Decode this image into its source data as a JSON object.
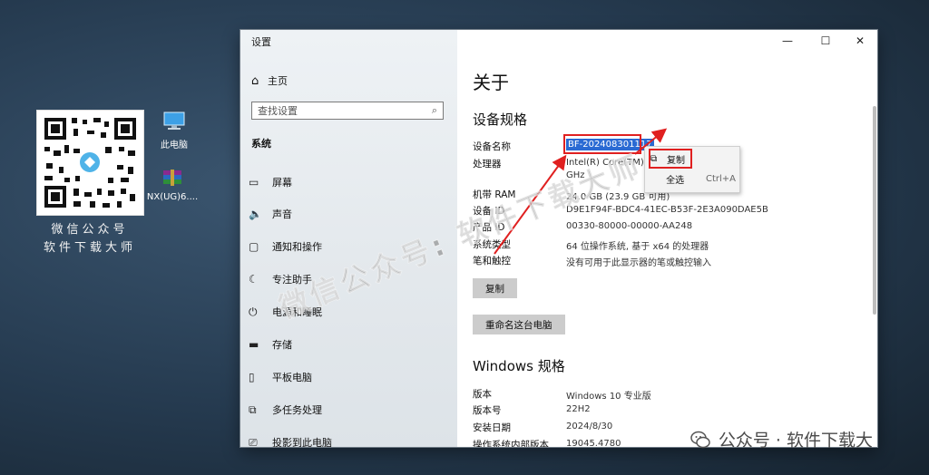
{
  "desktop": {
    "qr_caption_line1": "微信公众号",
    "qr_caption_line2": "软件下载大师",
    "icons": [
      {
        "label": "此电脑"
      },
      {
        "label": "NX(UG)6...."
      }
    ]
  },
  "window": {
    "title": "设置",
    "controls": {
      "minimize": "—",
      "maximize": "☐",
      "close": "✕"
    },
    "sidebar": {
      "home": "主页",
      "search_placeholder": "查找设置",
      "section": "系统",
      "items": [
        {
          "label": "屏幕",
          "icon": "monitor-icon"
        },
        {
          "label": "声音",
          "icon": "speaker-icon"
        },
        {
          "label": "通知和操作",
          "icon": "notification-icon"
        },
        {
          "label": "专注助手",
          "icon": "moon-icon"
        },
        {
          "label": "电源和睡眠",
          "icon": "power-icon"
        },
        {
          "label": "存储",
          "icon": "storage-icon"
        },
        {
          "label": "平板电脑",
          "icon": "tablet-icon"
        },
        {
          "label": "多任务处理",
          "icon": "multitask-icon"
        },
        {
          "label": "投影到此电脑",
          "icon": "project-icon"
        }
      ]
    },
    "content": {
      "title": "关于",
      "device_specs_heading": "设备规格",
      "specs": [
        {
          "key": "设备名称",
          "value": "BF-202408301117"
        },
        {
          "key": "处理器",
          "value": "Intel(R) Core(TM)                              3.60"
        },
        {
          "key": "",
          "value": "GHz"
        },
        {
          "key": "机带 RAM",
          "value": "24.0 GB (23.9 GB 可用)"
        },
        {
          "key": "设备 ID",
          "value": "D9E1F94F-BDC4-41EC-B53F-2E3A090DAE5B"
        },
        {
          "key": "产品 ID",
          "value": "00330-80000-00000-AA248"
        },
        {
          "key": "系统类型",
          "value": "64 位操作系统, 基于 x64 的处理器"
        },
        {
          "key": "笔和触控",
          "value": "没有可用于此显示器的笔或触控输入"
        }
      ],
      "copy_button": "复制",
      "rename_button": "重命名这台电脑",
      "windows_heading": "Windows 规格",
      "win_specs": [
        {
          "key": "版本",
          "value": "Windows 10 专业版"
        },
        {
          "key": "版本号",
          "value": "22H2"
        },
        {
          "key": "安装日期",
          "value": "2024/8/30"
        },
        {
          "key": "操作系统内部版本",
          "value": "19045.4780"
        }
      ]
    },
    "context_menu": {
      "items": [
        {
          "label": "复制",
          "shortcut": ""
        },
        {
          "label": "全选",
          "shortcut": "Ctrl+A"
        }
      ]
    }
  },
  "watermark": {
    "diagonal": "微信公众号: 软件下载大师",
    "footer": "公众号 · 软件下载大"
  }
}
